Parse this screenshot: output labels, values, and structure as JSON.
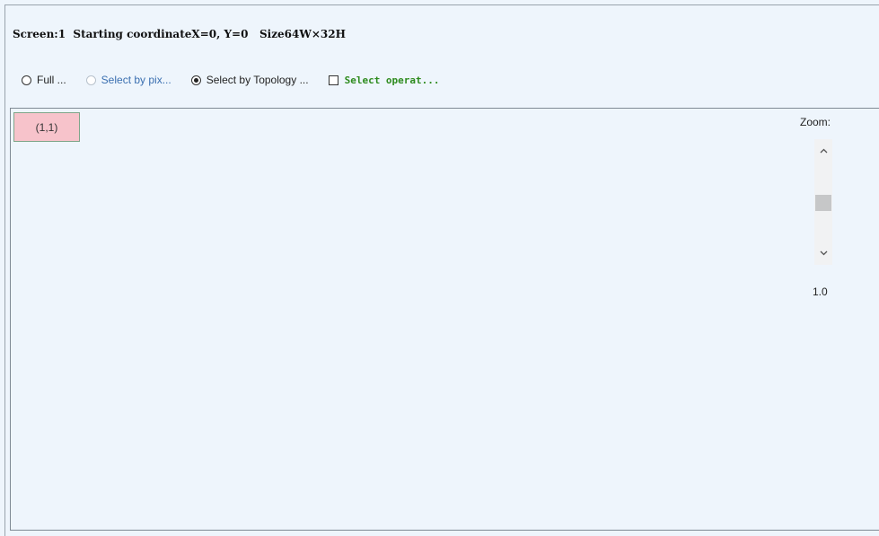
{
  "header": {
    "info": "Screen:1  Starting coordinateX=0, Y=0   Size64W×32H"
  },
  "options": {
    "full": "Full ...",
    "by_pixel": "Select by pix...",
    "by_topology": "Select by Topology ...",
    "select_operat": "Select operat..."
  },
  "canvas": {
    "cell_label": "(1,1)",
    "cell_color": "#f7c3cb"
  },
  "zoom": {
    "label": "Zoom:",
    "value": "1.0",
    "up_icon": "chevron-up-icon",
    "down_icon": "chevron-down-icon"
  },
  "colors": {
    "background": "#eef5fc",
    "disabled_text": "#3a6fb0",
    "operat_text": "#2e8b1e"
  }
}
